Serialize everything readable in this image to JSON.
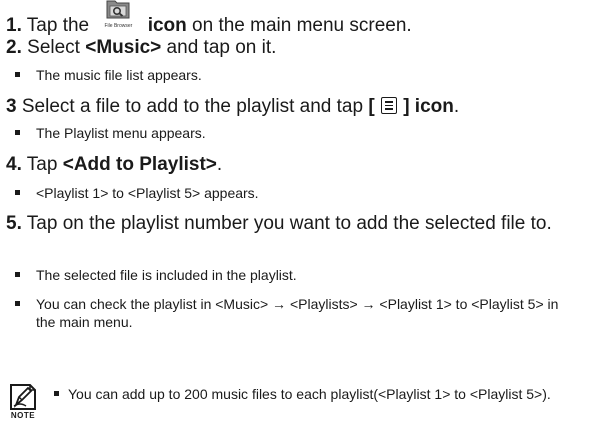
{
  "steps": [
    {
      "number": "1.",
      "pre": "Tap the",
      "icon_caption": "File Browser",
      "bold": "icon",
      "post": " on the main menu screen."
    },
    {
      "number": "2.",
      "pre": "Select ",
      "bold": "<Music>",
      "post": " and tap on it.",
      "bullets": [
        "The music file list appears."
      ]
    },
    {
      "number": "3",
      "pre": "Select a file to add to the playlist and tap ",
      "bold_open": "[",
      "bold_close": "] icon",
      "post": ".",
      "bullets": [
        "The Playlist menu appears."
      ]
    },
    {
      "number": "4.",
      "pre": "Tap ",
      "bold": "<Add to Playlist>",
      "post": ".",
      "bullets": [
        "<Playlist 1> to <Playlist 5> appears."
      ]
    },
    {
      "number": "5.",
      "text": "Tap on the playlist number you want to add the selected file to.",
      "bullets": [
        "The selected file is included in the playlist.",
        "You can check the playlist in <Music> → <Playlists> → <Playlist 1> to <Playlist 5> in the main menu."
      ]
    }
  ],
  "note": {
    "label": "NOTE",
    "text": "You can add up to 200 music files to each playlist(<Playlist 1> to <Playlist 5>)."
  },
  "icons": [
    "file-browser-icon",
    "menu-icon",
    "note-icon"
  ]
}
